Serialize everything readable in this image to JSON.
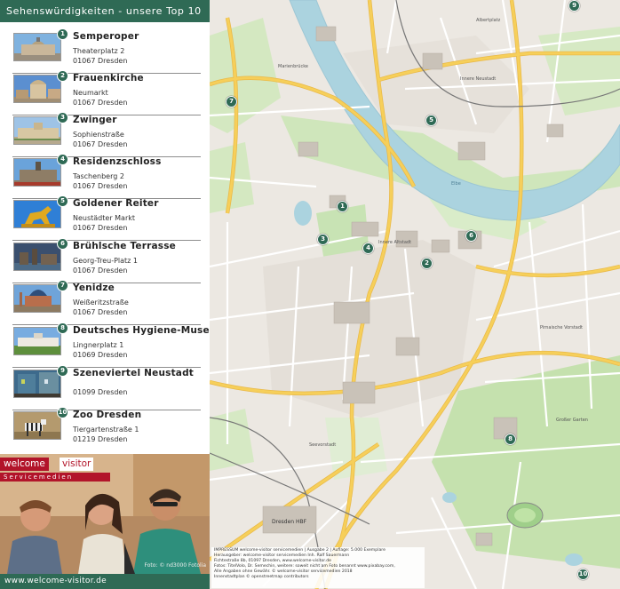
{
  "sidebar": {
    "title": "Sehenswürdigkeiten - unsere Top 10",
    "items": [
      {
        "num": "1",
        "name": "Semperoper",
        "street": "Theaterplatz 2",
        "city": "01067 Dresden",
        "thumb": "opera-house-photo"
      },
      {
        "num": "2",
        "name": "Frauenkirche",
        "street": "Neumarkt",
        "city": "01067 Dresden",
        "thumb": "church-photo"
      },
      {
        "num": "3",
        "name": "Zwinger",
        "street": "Sophienstraße",
        "city": "01067 Dresden",
        "thumb": "palace-photo"
      },
      {
        "num": "4",
        "name": "Residenzschloss",
        "street": "Taschenberg 2",
        "city": "01067 Dresden",
        "thumb": "castle-photo"
      },
      {
        "num": "5",
        "name": "Goldener Reiter",
        "street": "Neustädter Markt",
        "city": "01067 Dresden",
        "thumb": "golden-statue-photo"
      },
      {
        "num": "6",
        "name": "Brühlsche Terrasse",
        "street": "Georg-Treu-Platz 1",
        "city": "01067 Dresden",
        "thumb": "terrace-photo"
      },
      {
        "num": "7",
        "name": "Yenidze",
        "street": "Weißeritzstraße",
        "city": "01067 Dresden",
        "thumb": "domed-building-photo"
      },
      {
        "num": "8",
        "name": "Deutsches Hygiene-Museum",
        "street": "Lingnerplatz 1",
        "city": "01069 Dresden",
        "thumb": "museum-photo"
      },
      {
        "num": "9",
        "name": "Szeneviertel Neustadt",
        "street": "",
        "city": "01099 Dresden",
        "thumb": "courtyard-photo"
      },
      {
        "num": "10",
        "name": "Zoo Dresden",
        "street": "Tiergartenstraße 1",
        "city": "01219 Dresden",
        "thumb": "zebra-photo"
      }
    ]
  },
  "promo": {
    "logo_part1": "welcome",
    "logo_part2": "visitor",
    "logo_sub": "Servicemedien",
    "photo_credit": "Foto: © nd3000 Fotolia"
  },
  "footer": {
    "url": "www.welcome-visitor.de"
  },
  "map": {
    "labels": {
      "neustadt": "Innere Neustadt",
      "altstadt": "Innere Altstadt",
      "marienbruecke": "Marienbrücke",
      "hbf": "Dresden HBF",
      "pirnaische": "Pirnaische Vorstadt",
      "seevorstadt": "Seevorstadt",
      "elbe": "Elbe",
      "grosser_garten": "Großer Garten",
      "albertplatz": "Albertplatz"
    },
    "pins": [
      "1",
      "2",
      "3",
      "4",
      "5",
      "6",
      "7",
      "8",
      "9",
      "10"
    ],
    "imprint": [
      "IMPRESSUM   welcome-visitor servicemedien | Ausgabe 2 | Auflage: 5.000 Exemplare",
      "Herausgeber: welcome-visitor servicemedien Inh. Ralf Sauermann",
      "Fichtestraße 8b, 01097 Dresden, www.welcome-visitor.de",
      "Fotos: TitelVolo, Dr. Semechin, weitere: soweit nicht am Foto benannt www.pixabay.com,",
      "Alle Angaben ohne Gewähr. © welcome-visitor servicemedien 2018",
      "Innenstadtplan © openstreetmap contributors"
    ],
    "colors": {
      "water": "#abd3df",
      "park": "#c8e3b4",
      "major_road": "#f6cf5a",
      "pin": "#2f6a55"
    }
  }
}
